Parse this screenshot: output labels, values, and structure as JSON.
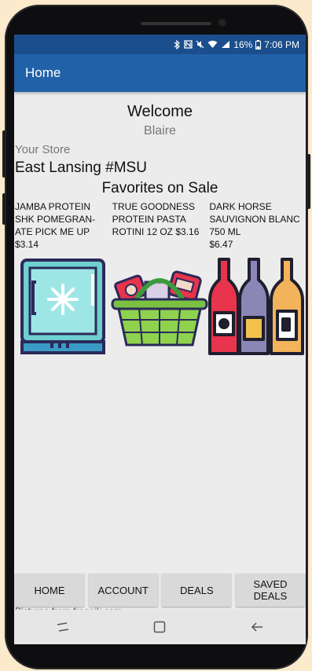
{
  "status_bar": {
    "icons": [
      "bluetooth-icon",
      "nfc-icon",
      "mute-icon",
      "wifi-icon",
      "signal-icon",
      "battery-icon"
    ],
    "battery": "16%",
    "time": "7:06 PM"
  },
  "app_bar": {
    "title": "Home"
  },
  "greeting": {
    "welcome": "Welcome",
    "user": "Blaire"
  },
  "store": {
    "label": "Your Store",
    "name": "East Lansing #MSU"
  },
  "favorites": {
    "title": "Favorites on Sale",
    "items": [
      {
        "name": "JAMBA PROTEIN SHK POMEGRAN-ATE PICK ME UP",
        "price": "$3.14",
        "image": "freezer-icon"
      },
      {
        "name": "TRUE GOODNESS PROTEIN PASTA ROTINI 12 OZ",
        "price": "$3.16",
        "image": "grocery-basket-icon"
      },
      {
        "name": "DARK HORSE SAUVIGNON BLANC 750 ML",
        "price": "$6.47",
        "image": "wine-bottles-icon"
      }
    ]
  },
  "credit": "Pictures from freepik.com",
  "tabs": [
    "HOME",
    "ACCOUNT",
    "DEALS",
    "SAVED DEALS"
  ],
  "colors": {
    "status_bar": "#1b4e8c",
    "app_bar": "#2161a8",
    "background": "#ececec"
  }
}
